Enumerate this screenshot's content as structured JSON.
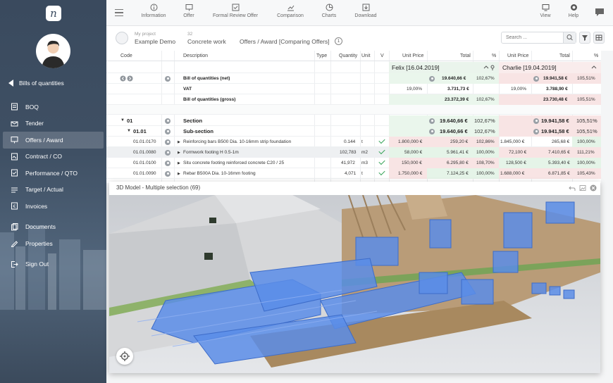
{
  "sidebar": {
    "back_label": "Bills of quantities",
    "items": [
      {
        "label": "BOQ",
        "icon": "boq-icon"
      },
      {
        "label": "Tender",
        "icon": "tender-icon"
      },
      {
        "label": "Offers / Award",
        "icon": "offers-icon",
        "active": true
      },
      {
        "label": "Contract / CO",
        "icon": "contract-icon"
      },
      {
        "label": "Performance / QTO",
        "icon": "performance-icon"
      },
      {
        "label": "Target / Actual",
        "icon": "target-icon"
      },
      {
        "label": "Invoices",
        "icon": "invoices-icon"
      },
      {
        "label": "Documents",
        "icon": "documents-icon"
      },
      {
        "label": "Properties",
        "icon": "properties-icon"
      },
      {
        "label": "Sign Out",
        "icon": "sign-out-icon"
      }
    ]
  },
  "toolbar": {
    "information": "Information",
    "offer": "Offer",
    "formal_review": "Formal Review Offer",
    "comparison": "Comparison",
    "charts": "Charts",
    "download": "Download",
    "view": "View",
    "help": "Help"
  },
  "breadcrumb": {
    "project_caption": "My project",
    "project": "Example Demo",
    "boq_caption": "32",
    "boq": "Concrete work",
    "page": "Offers / Award [Comparing Offers]",
    "info_count": "1"
  },
  "search": {
    "placeholder": "Search ..."
  },
  "grid": {
    "headers": {
      "code": "Code",
      "description": "Description",
      "type": "Type",
      "quantity": "Quantity",
      "unit": "Unit",
      "v": "V",
      "unit_price": "Unit Price",
      "total": "Total",
      "percent": "%"
    },
    "bidders": [
      {
        "name": "Felix [16.04.2019]"
      },
      {
        "name": "Charlie [19.04.2019]"
      }
    ],
    "summary": [
      {
        "label": "Bill of quantities (net)",
        "felix_total": "19.640,66 €",
        "felix_pct": "102,67%",
        "charlie_total": "19.941,58 €",
        "charlie_pct": "105,51%"
      },
      {
        "label": "VAT",
        "felix_rate": "19,00%",
        "felix_total": "3.731,73 €",
        "charlie_rate": "19,00%",
        "charlie_total": "3.788,90 €"
      },
      {
        "label": "Bill of quantities (gross)",
        "felix_total": "23.372,39 €",
        "felix_pct": "102,67%",
        "charlie_total": "23.730,48 €",
        "charlie_pct": "105,51%"
      }
    ],
    "sections": [
      {
        "code": "01",
        "label": "Section",
        "felix_total": "19.640,66 €",
        "felix_pct": "102,67%",
        "charlie_total": "19.941,58 €",
        "charlie_pct": "105,51%"
      },
      {
        "code": "01.01",
        "label": "Sub-section",
        "felix_total": "19.640,66 €",
        "felix_pct": "102,67%",
        "charlie_total": "19.941,58 €",
        "charlie_pct": "105,51%"
      }
    ],
    "rows": [
      {
        "code": "01.01.0170",
        "description": "Reinforcing bars B500 Dia. 10-16mm strip foundation",
        "quantity": "0.144",
        "unit": "t",
        "felix_up": "1.800,000 €",
        "felix_total": "259,20 €",
        "felix_pct": "102,86%",
        "charlie_up": "1.845,000 €",
        "charlie_total": "265,68 €",
        "charlie_pct": "100,00%"
      },
      {
        "code": "01.01.0080",
        "description": "Formwork footing H 0.5-1m",
        "quantity": "102,783",
        "unit": "m2",
        "felix_up": "58,000 €",
        "felix_total": "5.961,41 €",
        "felix_pct": "100,00%",
        "charlie_up": "72,100 €",
        "charlie_total": "7.410,65 €",
        "charlie_pct": "111,21%"
      },
      {
        "code": "01.01.0100",
        "description": "Situ concrete footing reinforced concrete C20 / 25",
        "quantity": "41,972",
        "unit": "m3",
        "felix_up": "150,000 €",
        "felix_total": "6.295,80 €",
        "felix_pct": "108,70%",
        "charlie_up": "128,500 €",
        "charlie_total": "5.393,40 €",
        "charlie_pct": "100,00%"
      },
      {
        "code": "01.01.0090",
        "description": "Rebar B500A Dia. 10-16mm footing",
        "quantity": "4,071",
        "unit": "t",
        "felix_up": "1.750,000 €",
        "felix_total": "7.124,25 €",
        "felix_pct": "100,00%",
        "charlie_up": "1.688,000 €",
        "charlie_total": "6.871,85 €",
        "charlie_pct": "105,43%"
      }
    ]
  },
  "model_panel": {
    "title": "3D Model - Multiple selection (69)"
  },
  "colors": {
    "sidebar": "#3f5064",
    "accent_green": "#3aa55b",
    "cheap": "#e5f4e8",
    "expensive": "#f8e4e4",
    "selection": "#5b8de8"
  }
}
